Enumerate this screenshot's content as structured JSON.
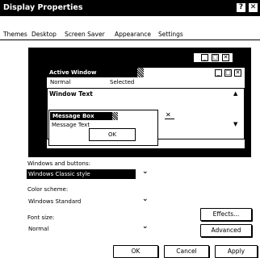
{
  "window": {
    "title": "Display Properties",
    "help_glyph": "?",
    "close_glyph": "✕"
  },
  "tabs": [
    "Themes",
    "Desktop",
    "Screen Saver",
    "Appearance",
    "Settings"
  ],
  "preview": {
    "inactive_window_buttons": [
      "_",
      "□",
      "✕"
    ],
    "active_window_title": "Active Window",
    "active_window_buttons": [
      "_",
      "□",
      "✕"
    ],
    "menu_normal": "Normal",
    "menu_selected": "Selected",
    "window_text": "Window Text",
    "message_box_title": "Message Box",
    "message_box_close": "✕",
    "message_text": "Message Text",
    "ok_label": "OK",
    "scroll_up": "▲",
    "scroll_down": "▼"
  },
  "windows_and_buttons": {
    "label": "Windows and buttons:",
    "value": "Windows Classic style"
  },
  "color_scheme": {
    "label": "Color scheme:",
    "value": "Windows Standard"
  },
  "font_size": {
    "label": "Font size:",
    "value": "Normal"
  },
  "buttons": {
    "effects": "Effects...",
    "advanced": "Advanced",
    "ok": "OK",
    "cancel": "Cancel",
    "apply": "Apply"
  },
  "chevron": "⌄"
}
